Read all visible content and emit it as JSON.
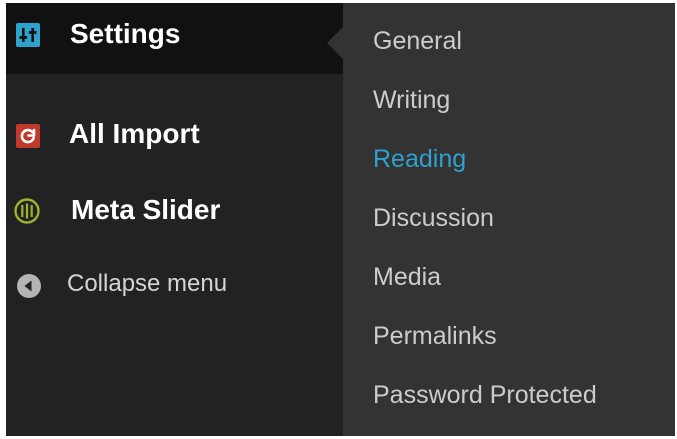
{
  "colors": {
    "menu_bg": "#222222",
    "active_item_bg": "#111111",
    "submenu_bg": "#333333",
    "submenu_text": "#cccccc",
    "highlight": "#2ea2cc",
    "settings_icon": "#2ea2cc",
    "allimport_icon": "#c0392b",
    "metaslider_icon": "#9cb42e"
  },
  "sidebar": {
    "items": [
      {
        "label": "Settings",
        "icon": "settings-sliders-icon",
        "active": true
      },
      {
        "label": "All Import",
        "icon": "all-import-icon"
      },
      {
        "label": "Meta Slider",
        "icon": "meta-slider-icon"
      },
      {
        "label": "Collapse menu",
        "icon": "collapse-arrow-icon"
      }
    ]
  },
  "submenu": {
    "items": [
      {
        "label": "General"
      },
      {
        "label": "Writing"
      },
      {
        "label": "Reading",
        "current": true
      },
      {
        "label": "Discussion"
      },
      {
        "label": "Media"
      },
      {
        "label": "Permalinks"
      },
      {
        "label": "Password Protected"
      }
    ]
  }
}
